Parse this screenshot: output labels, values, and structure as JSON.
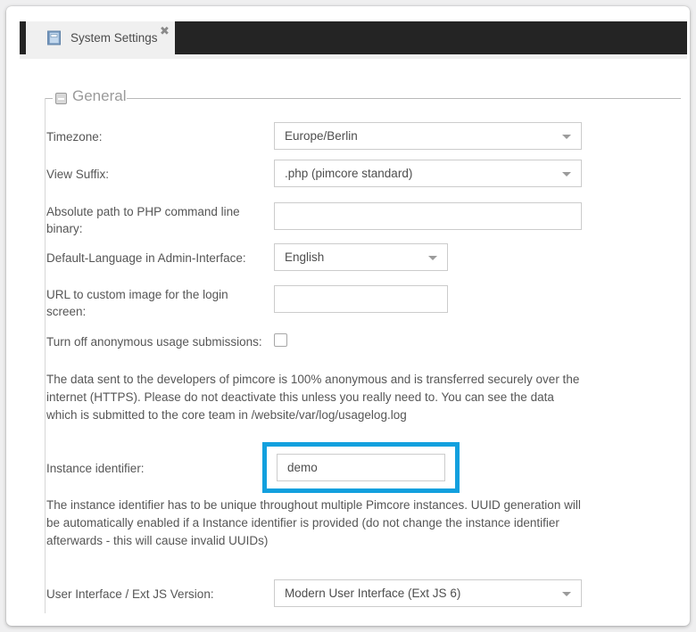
{
  "window": {
    "background_color": "#efeff0",
    "card_color": "#ffffff"
  },
  "tabbar": {
    "background_color": "#242424",
    "tabs": [
      {
        "label": "System Settings",
        "icon": "book-icon",
        "close_glyph": "✖",
        "active": true
      }
    ]
  },
  "fieldset": {
    "legend": "General",
    "collapse_icon": "collapse-minus-icon"
  },
  "form": {
    "fields": [
      {
        "label": "Timezone:",
        "type": "combobox",
        "value": "Europe/Berlin"
      },
      {
        "label": "View Suffix:",
        "type": "combobox",
        "value": ".php (pimcore standard)"
      },
      {
        "label": "Absolute path to PHP command line binary:",
        "type": "text",
        "value": "",
        "placeholder": ""
      },
      {
        "label": "Default-Language in Admin-Interface:",
        "type": "combobox",
        "value": "English"
      },
      {
        "label": "URL to custom image for the login screen:",
        "type": "text",
        "value": "",
        "placeholder": ""
      },
      {
        "label": "Turn off anonymous usage submissions:",
        "type": "checkbox",
        "checked": false
      },
      {
        "label": "Instance identifier:",
        "type": "text",
        "value": "demo",
        "placeholder": "",
        "highlighted": true
      },
      {
        "label": "User Interface / Ext JS Version:",
        "type": "combobox",
        "value": "Modern User Interface (Ext JS 6)"
      }
    ],
    "notes": [
      "The data sent to the developers of pimcore is 100% anonymous and is transferred securely over the internet (HTTPS). Please do not deactivate this unless you really need to. You can see the data which is submitted to the core team in /website/var/log/usagelog.log",
      "The instance identifier has to be unique throughout multiple Pimcore instances. UUID generation will be automatically enabled if a Instance identifier is provided (do not change the instance identifier afterwards - this will cause invalid UUIDs)"
    ]
  },
  "highlight": {
    "color": "#12a0de"
  }
}
